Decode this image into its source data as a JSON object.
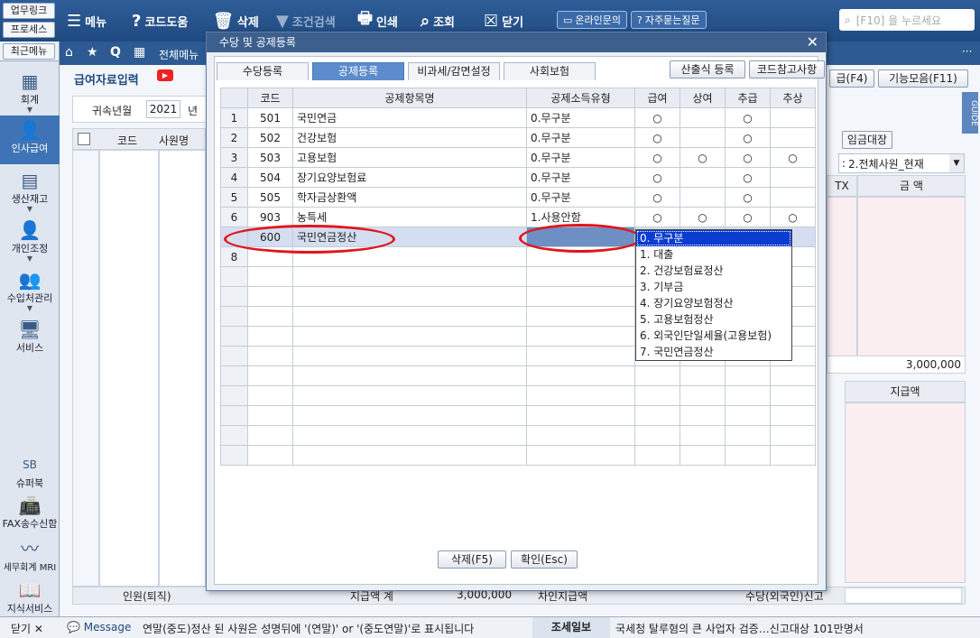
{
  "quicklinks": [
    "업무링크",
    "프로세스",
    "최근메뉴"
  ],
  "toolbar": {
    "menu": "메뉴",
    "code_help": "코드도움",
    "delete": "삭제",
    "filter": "조건검색",
    "print": "인쇄",
    "search": "조회",
    "close": "닫기",
    "online_inquiry": "온라인문의",
    "faq": "자주묻는질문",
    "search_placeholder": "[F10] 을 누르세요"
  },
  "bar2": {
    "all_menu": "전체메뉴"
  },
  "leftnav": [
    {
      "label": "회계"
    },
    {
      "label": "인사급여"
    },
    {
      "label": "생산재고"
    },
    {
      "label": "개인조정"
    },
    {
      "label": "수입처관리"
    },
    {
      "label": "서비스"
    },
    {
      "label": "슈퍼북"
    },
    {
      "label": "FAX송수신함"
    },
    {
      "label": "세무회계 MRI"
    },
    {
      "label": "지식서비스"
    }
  ],
  "page": {
    "title": "급여자료입력",
    "year_label": "귀속년월",
    "year": "2021",
    "year_unit": "년",
    "col_code": "코드",
    "col_name": "사원명",
    "right_btn1": "급(F4)",
    "right_btn2": "기능모음(F11)",
    "wage_ledger": "임금대장",
    "employee_filter_prefix": ":",
    "employee_filter": "2.전체사원_현재",
    "col_tx": "TX",
    "col_amount": "금 액",
    "total_amount": "3,000,000",
    "col_pay": "지급액",
    "footer_people": "인원(퇴직)",
    "footer_total": "지급액 계",
    "footer_total_val": "3,000,000",
    "footer_actual": "차인지급액",
    "footer_right": "수당(외국인)신고",
    "guide": "GUIDE"
  },
  "status": {
    "close": "닫기",
    "message": "Message",
    "message_text": "연말(중도)정산 된 사원은 성명뒤에 '(연말)' or '(중도연말)'로 표시됩니다",
    "news_label": "조세일보",
    "news_text": "국세청 탈루혐의 큰 사업자 검증…신고대상 101만명서"
  },
  "dialog": {
    "title": "수당 및 공제등록",
    "tabs": [
      "수당등록",
      "공제등록",
      "비과세/감면설정",
      "사회보험"
    ],
    "btn_formula": "산출식 등록",
    "btn_code_ref": "코드참고사항",
    "btn_delete": "삭제(F5)",
    "btn_confirm": "확인(Esc)",
    "grid": {
      "headers": [
        "코드",
        "공제항목명",
        "공제소득유형",
        "급여",
        "상여",
        "추급",
        "추상"
      ],
      "rows": [
        {
          "n": "1",
          "code": "501",
          "name": "국민연금",
          "type": "0.무구분",
          "m": [
            "○",
            "",
            "○",
            ""
          ]
        },
        {
          "n": "2",
          "code": "502",
          "name": "건강보험",
          "type": "0.무구분",
          "m": [
            "○",
            "",
            "○",
            ""
          ]
        },
        {
          "n": "3",
          "code": "503",
          "name": "고용보험",
          "type": "0.무구분",
          "m": [
            "○",
            "○",
            "○",
            "○"
          ]
        },
        {
          "n": "4",
          "code": "504",
          "name": "장기요양보험료",
          "type": "0.무구분",
          "m": [
            "○",
            "",
            "○",
            ""
          ]
        },
        {
          "n": "5",
          "code": "505",
          "name": "학자금상환액",
          "type": "0.무구분",
          "m": [
            "○",
            "",
            "○",
            ""
          ]
        },
        {
          "n": "6",
          "code": "903",
          "name": "농특세",
          "type": "1.사용안함",
          "m": [
            "○",
            "○",
            "○",
            "○"
          ]
        },
        {
          "n": "",
          "code": "600",
          "name": "국민연금정산",
          "type": "",
          "m": [
            "",
            "",
            "",
            ""
          ]
        },
        {
          "n": "8",
          "code": "",
          "name": "",
          "type": "",
          "m": [
            "",
            "",
            "",
            ""
          ]
        }
      ]
    },
    "dropdown": [
      "0. 무구분",
      "1. 대출",
      "2. 건강보험료정산",
      "3. 기부금",
      "4. 장기요양보험정산",
      "5. 고용보험정산",
      "6. 외국인단일세율(고용보험)",
      "7. 국민연금정산"
    ]
  }
}
